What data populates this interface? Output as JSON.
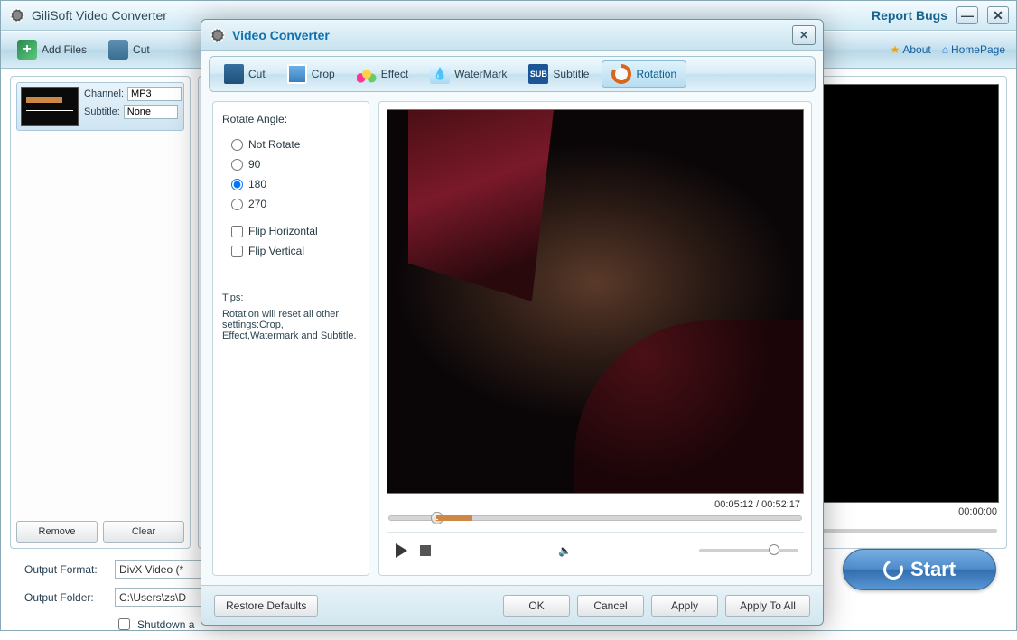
{
  "main": {
    "title": "GiliSoft Video Converter",
    "report_bugs": "Report Bugs",
    "toolbar": {
      "add_files": "Add Files",
      "cut": "Cut"
    },
    "links": {
      "about": "About",
      "homepage": "HomePage"
    },
    "file": {
      "channel_label": "Channel:",
      "channel_value": "MP3",
      "subtitle_label": "Subtitle:",
      "subtitle_value": "None"
    },
    "remove": "Remove",
    "clear": "Clear",
    "preview_time": "00:00:00",
    "output_format_label": "Output Format:",
    "output_format_value": "DivX Video (*",
    "output_folder_label": "Output Folder:",
    "output_folder_value": "C:\\Users\\zs\\D",
    "shutdown": "Shutdown a",
    "start": "Start"
  },
  "modal": {
    "title": "Video Converter",
    "tabs": {
      "cut": "Cut",
      "crop": "Crop",
      "effect": "Effect",
      "watermark": "WaterMark",
      "subtitle": "Subtitle",
      "rotation": "Rotation"
    },
    "rotate_label": "Rotate Angle:",
    "options": {
      "not_rotate": "Not Rotate",
      "r90": "90",
      "r180": "180",
      "r270": "270",
      "flip_h": "Flip Horizontal",
      "flip_v": "Flip Vertical"
    },
    "selected_angle": "180",
    "tips_title": "Tips:",
    "tips_body": "Rotation will reset all other settings:Crop, Effect,Watermark and Subtitle.",
    "time": {
      "current": "00:05:12",
      "total": "00:52:17",
      "sep": " / "
    },
    "seek_percent": 10,
    "volume_percent": 70,
    "footer": {
      "restore": "Restore Defaults",
      "ok": "OK",
      "cancel": "Cancel",
      "apply": "Apply",
      "apply_all": "Apply To All"
    }
  }
}
